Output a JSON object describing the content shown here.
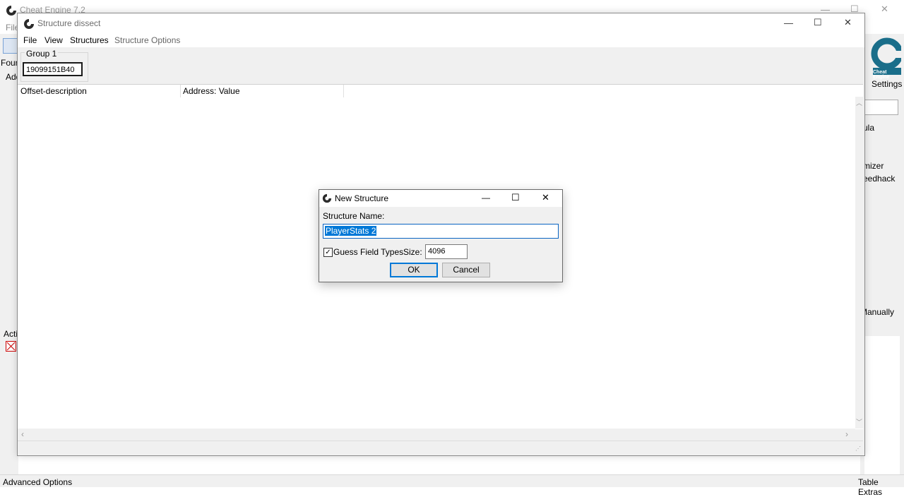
{
  "main_window": {
    "title": "Cheat Engine 7.2",
    "menu_file": "File",
    "sidebar_texts": [
      "Foun",
      "Add",
      "Acti"
    ],
    "right_texts": [
      "Settings",
      "ula",
      "mizer",
      "eedhack",
      "Manually"
    ],
    "logo_text": "Cheat Engine",
    "bottom_left": "Advanced Options",
    "bottom_right": "Table Extras"
  },
  "structure_dissect": {
    "title": "Structure dissect",
    "menu": [
      "File",
      "View",
      "Structures",
      "Structure Options"
    ],
    "group_label": "Group 1",
    "address_value": "19099151B40",
    "columns": [
      "Offset-description",
      "Address: Value"
    ]
  },
  "dialog": {
    "title": "New Structure",
    "name_label": "Structure Name:",
    "name_value": "PlayerStats 2",
    "guess_label": "Guess Field Types",
    "guess_checked": "✓",
    "size_label": "Size:",
    "size_value": "4096",
    "ok_label": "OK",
    "cancel_label": "Cancel"
  },
  "window_controls": {
    "minimize": "—",
    "maximize": "☐",
    "close": "✕"
  },
  "colors": {
    "accent": "#0078d7",
    "logo": "#1a6e8a"
  }
}
